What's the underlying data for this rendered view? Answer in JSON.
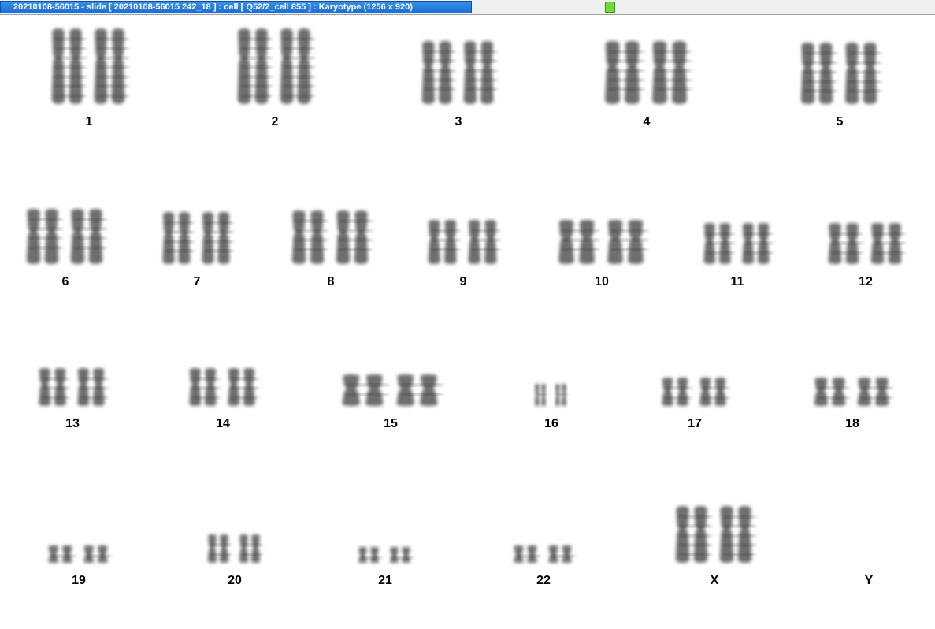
{
  "window": {
    "title": "20210108-56015 - slide [ 20210108-56015 242_18 ] : cell [ Q52/2_cell 855 ] : Karyotype  (1256 x 920)",
    "status_color": "#6fdb3a"
  },
  "karyotype": {
    "chromosome_color": "#555555",
    "labels": [
      "1",
      "2",
      "3",
      "4",
      "5",
      "6",
      "7",
      "8",
      "9",
      "10",
      "11",
      "12",
      "13",
      "14",
      "15",
      "16",
      "17",
      "18",
      "19",
      "20",
      "21",
      "22",
      "X",
      "Y"
    ]
  }
}
